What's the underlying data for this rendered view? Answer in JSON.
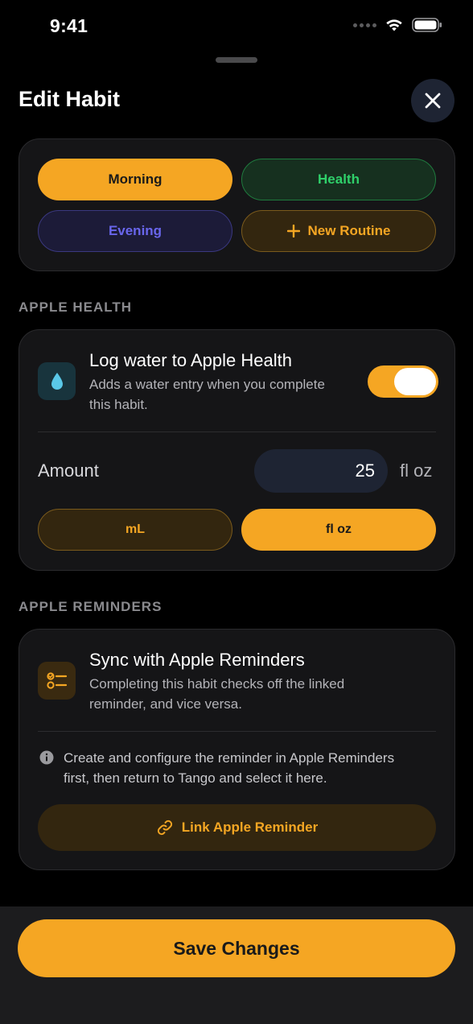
{
  "status_bar": {
    "time": "9:41"
  },
  "header": {
    "title": "Edit Habit",
    "close_icon": "xmark-icon"
  },
  "routines": {
    "items": [
      {
        "label": "Morning",
        "selected": true,
        "color": "#f5a623"
      },
      {
        "label": "Health",
        "selected": false,
        "color": "#2fd06a"
      },
      {
        "label": "Evening",
        "selected": false,
        "color": "#5e5ce6"
      },
      {
        "label": "New Routine",
        "icon": "plus-icon",
        "color": "#f5a623"
      }
    ]
  },
  "apple_health": {
    "section_label": "APPLE HEALTH",
    "title": "Log water to Apple Health",
    "subtitle_line1": "Adds a water entry when you complete",
    "subtitle_line2": "this habit.",
    "icon": "water-drop-icon",
    "toggle_on": true,
    "amount_label": "Amount",
    "amount_value": "25",
    "amount_unit": "fl oz",
    "units": [
      {
        "label": "mL",
        "selected": false
      },
      {
        "label": "fl oz",
        "selected": true
      }
    ]
  },
  "apple_reminders": {
    "section_label": "APPLE REMINDERS",
    "title": "Sync with Apple Reminders",
    "subtitle_line1": "Completing this habit checks off the linked",
    "subtitle_line2": "reminder, and vice versa.",
    "icon": "checklist-icon",
    "info_line1": "Create and configure the reminder in Apple Reminders",
    "info_line2": "first, then return to Tango and select it here.",
    "link_button": "Link Apple Reminder"
  },
  "footer": {
    "save_label": "Save Changes"
  },
  "colors": {
    "accent": "#f5a623",
    "background": "#000000",
    "card": "#151517"
  }
}
